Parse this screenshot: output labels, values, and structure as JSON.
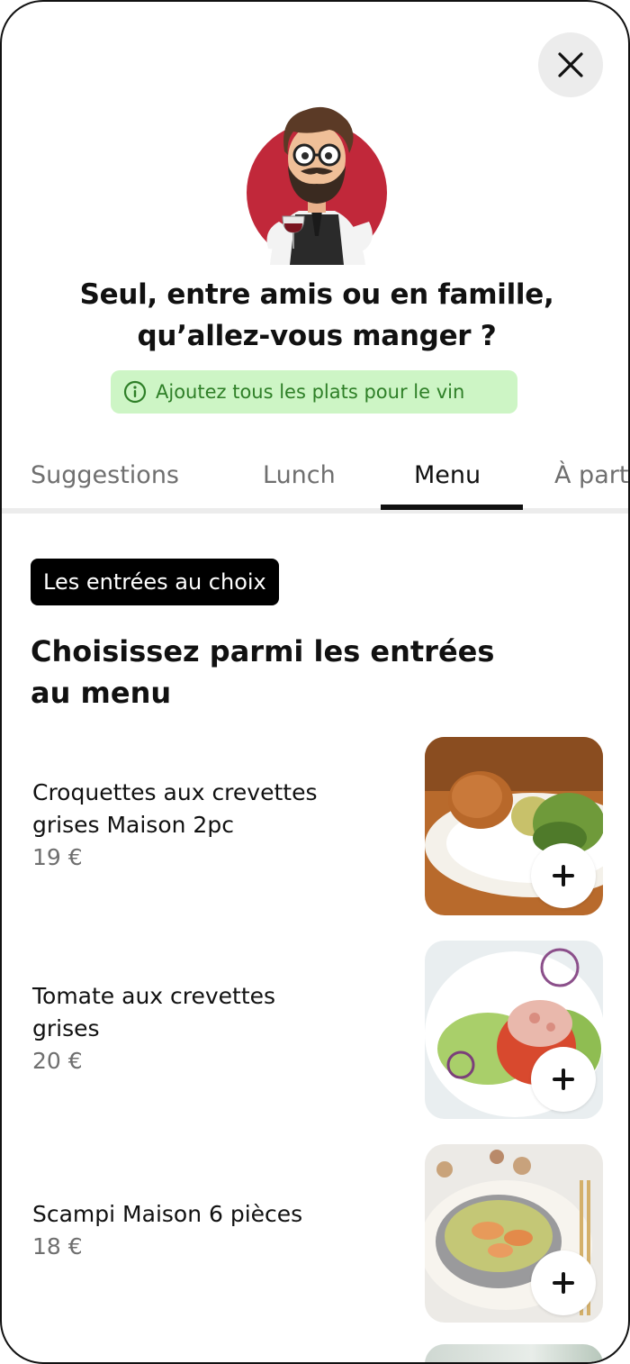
{
  "header": {
    "close_icon": "close-icon",
    "headline_line1": "Seul, entre amis ou en famille,",
    "headline_line2": "qu’allez-vous manger ?"
  },
  "info": {
    "icon": "info-icon",
    "text": "Ajoutez tous les plats pour le vin",
    "color": "#2e7f27",
    "background": "#cdf5c5"
  },
  "tabs": [
    {
      "label": "Suggestions",
      "active": false
    },
    {
      "label": "Lunch",
      "active": false
    },
    {
      "label": "Menu",
      "active": true
    },
    {
      "label": "À part",
      "active": false
    }
  ],
  "section": {
    "badge": "Les entrées au choix",
    "title_line1": "Choisissez parmi les entrées",
    "title_line2": "au menu"
  },
  "dishes": [
    {
      "name_line1": "Croquettes aux crevettes",
      "name_line2": "grises Maison 2pc",
      "price": "19 €",
      "add_icon": "plus-icon"
    },
    {
      "name_line1": "Tomate aux crevettes",
      "name_line2": "grises",
      "price": "20 €",
      "add_icon": "plus-icon"
    },
    {
      "name_line1": "Scampi Maison 6 pièces",
      "name_line2": "",
      "price": "18 €",
      "add_icon": "plus-icon"
    }
  ]
}
